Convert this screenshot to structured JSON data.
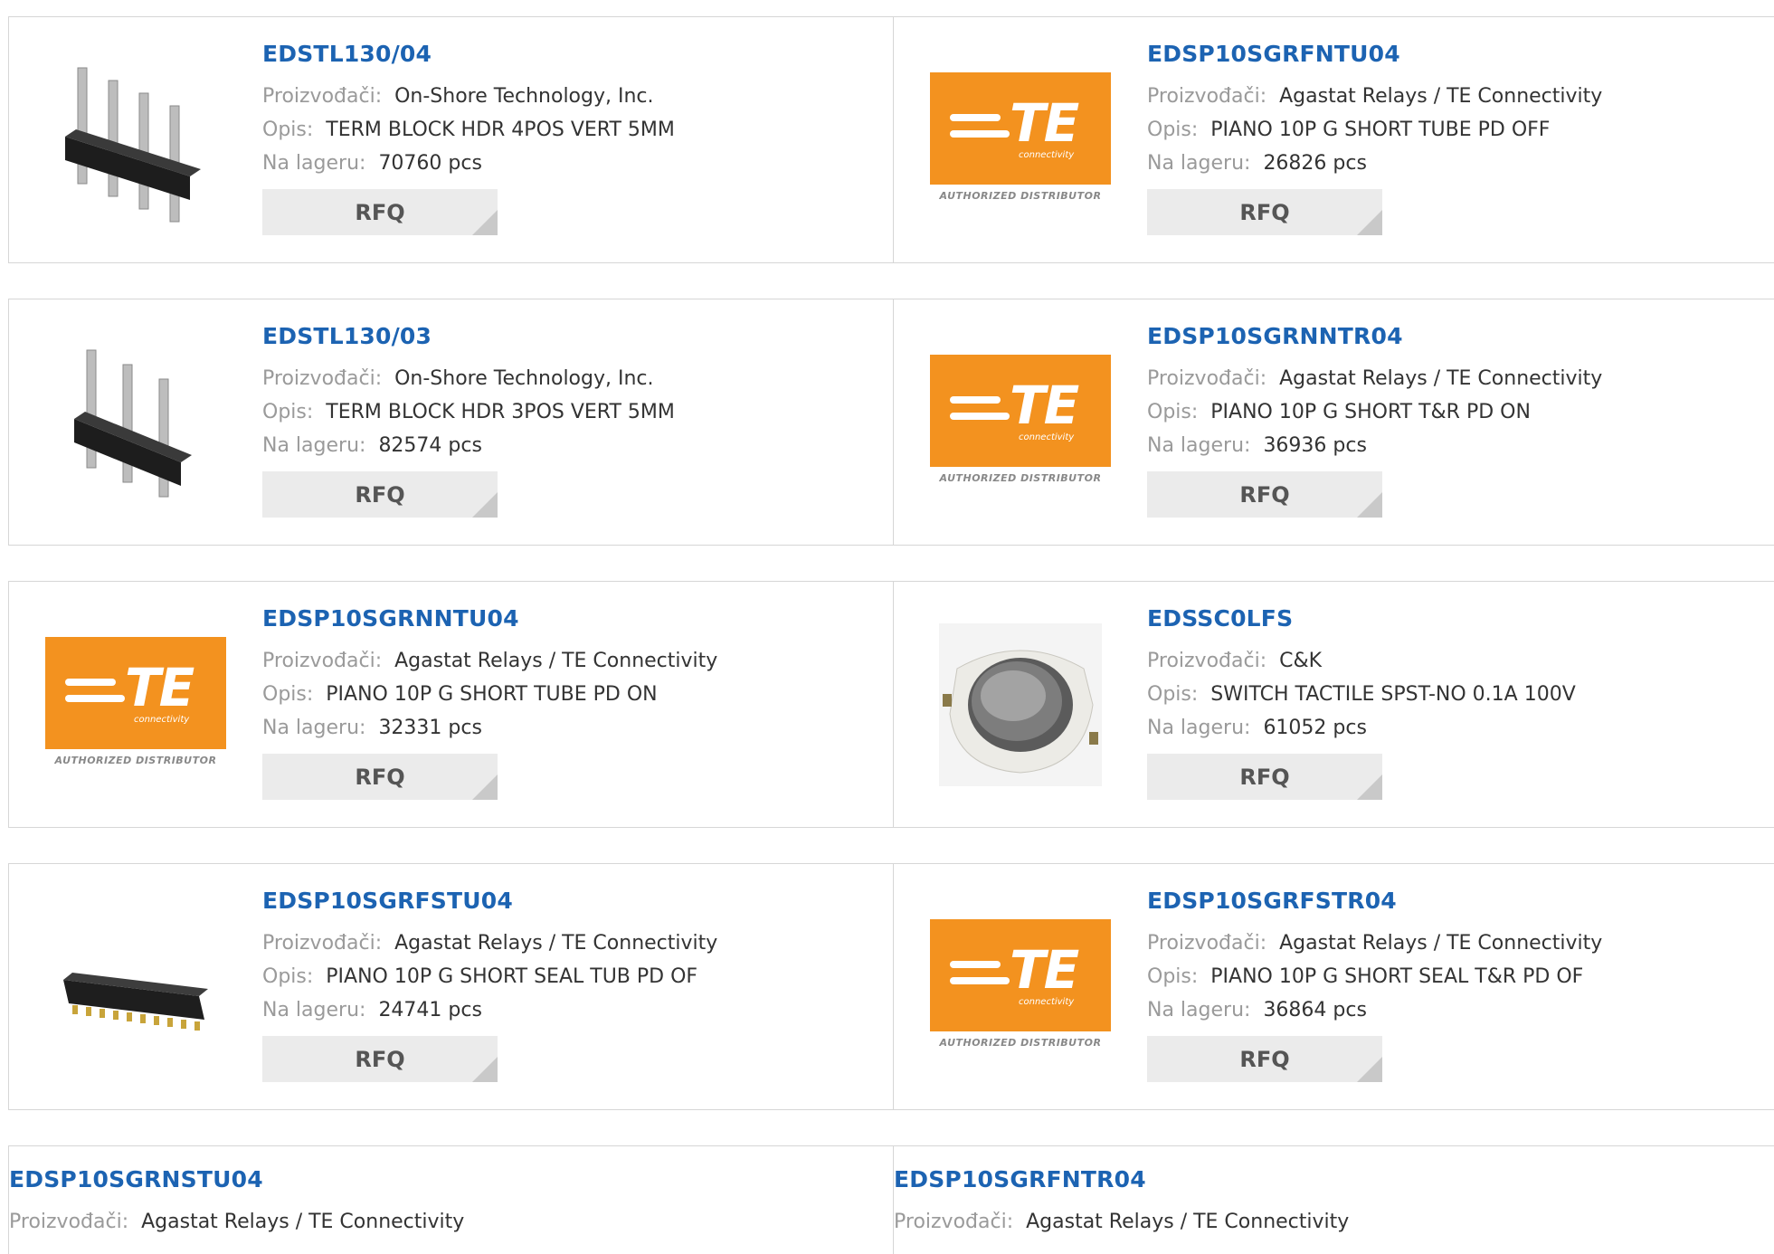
{
  "labels": {
    "manufacturer": "Proizvođači:",
    "description": "Opis:",
    "stock": "Na lageru:",
    "rfq": "RFQ"
  },
  "te_logo": {
    "letters": "TE",
    "subtitle": "connectivity",
    "distributor": "AUTHORIZED DISTRIBUTOR"
  },
  "colors": {
    "part_link": "#1c63b2",
    "te_orange": "#f3921f",
    "rfq_bg": "#ebebeb"
  },
  "products": [
    {
      "part": "EDSTL130/04",
      "manufacturer": "On-Shore Technology, Inc.",
      "description": "TERM BLOCK HDR 4POS VERT 5MM",
      "stock": "70760 pcs",
      "image": "header-4pin"
    },
    {
      "part": "EDSP10SGRFNTU04",
      "manufacturer": "Agastat Relays / TE Connectivity",
      "description": "PIANO 10P G SHORT TUBE PD OFF",
      "stock": "26826 pcs",
      "image": "te-logo"
    },
    {
      "part": "EDSTL130/03",
      "manufacturer": "On-Shore Technology, Inc.",
      "description": "TERM BLOCK HDR 3POS VERT 5MM",
      "stock": "82574 pcs",
      "image": "header-3pin"
    },
    {
      "part": "EDSP10SGRNNTR04",
      "manufacturer": "Agastat Relays / TE Connectivity",
      "description": "PIANO 10P G SHORT T&R PD ON",
      "stock": "36936 pcs",
      "image": "te-logo"
    },
    {
      "part": "EDSP10SGRNNTU04",
      "manufacturer": "Agastat Relays / TE Connectivity",
      "description": "PIANO 10P G SHORT TUBE PD ON",
      "stock": "32331 pcs",
      "image": "te-logo"
    },
    {
      "part": "EDSSC0LFS",
      "manufacturer": "C&K",
      "description": "SWITCH TACTILE SPST-NO 0.1A 100V",
      "stock": "61052 pcs",
      "image": "tactile-switch"
    },
    {
      "part": "EDSP10SGRFSTU04",
      "manufacturer": "Agastat Relays / TE Connectivity",
      "description": "PIANO 10P G SHORT SEAL TUB PD OF",
      "stock": "24741 pcs",
      "image": "dip-switch"
    },
    {
      "part": "EDSP10SGRFSTR04",
      "manufacturer": "Agastat Relays / TE Connectivity",
      "description": "PIANO 10P G SHORT SEAL T&R PD OF",
      "stock": "36864 pcs",
      "image": "te-logo"
    },
    {
      "part": "EDSP10SGRNSTU04",
      "manufacturer": "Agastat Relays / TE Connectivity",
      "description": "",
      "stock": "",
      "image": "none"
    },
    {
      "part": "EDSP10SGRFNTR04",
      "manufacturer": "Agastat Relays / TE Connectivity",
      "description": "",
      "stock": "",
      "image": "none"
    }
  ]
}
